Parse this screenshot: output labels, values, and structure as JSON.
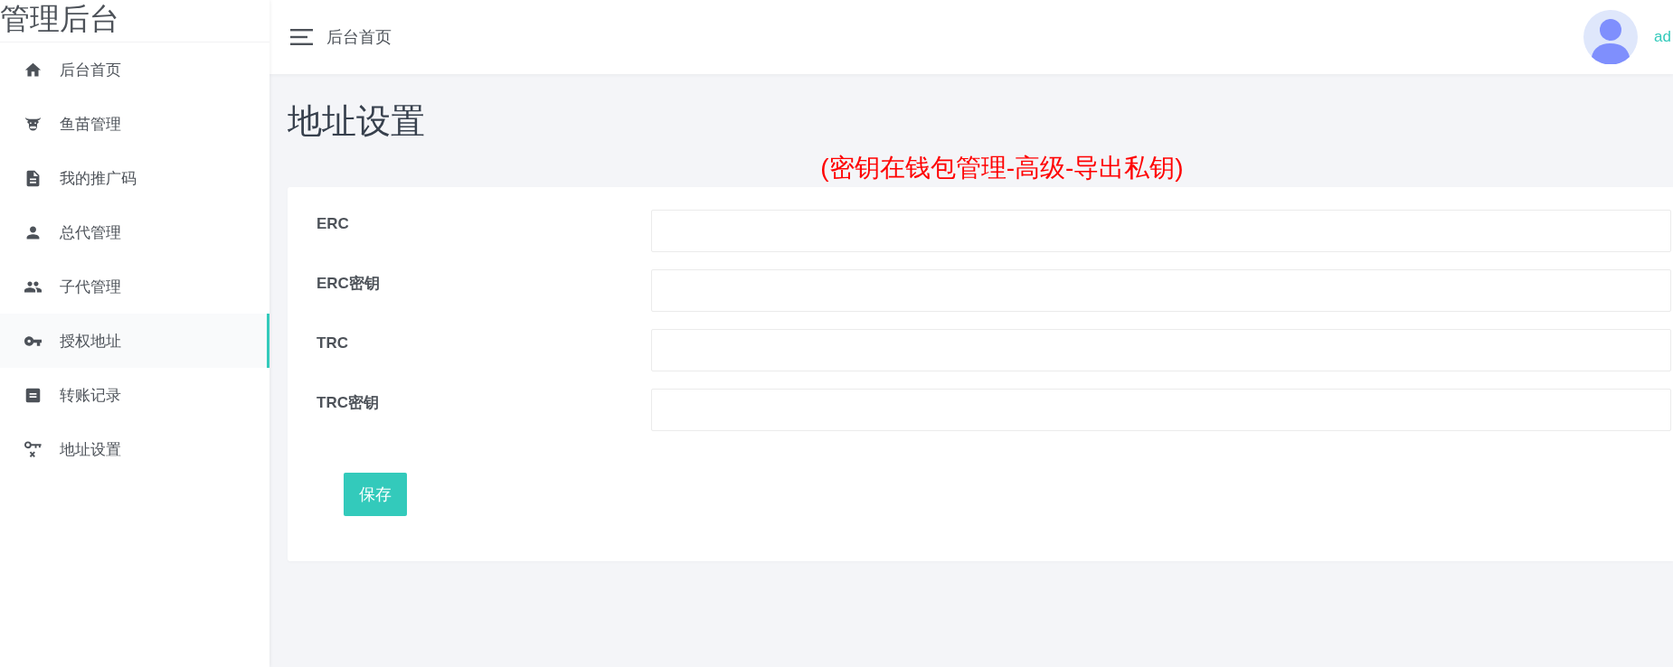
{
  "sidebar": {
    "logo": "管理后台",
    "items": [
      {
        "label": "后台首页",
        "selected": false
      },
      {
        "label": "鱼苗管理",
        "selected": false
      },
      {
        "label": "我的推广码",
        "selected": false
      },
      {
        "label": "总代管理",
        "selected": false
      },
      {
        "label": "子代管理",
        "selected": false
      },
      {
        "label": "授权地址",
        "selected": true
      },
      {
        "label": "转账记录",
        "selected": false
      },
      {
        "label": "地址设置",
        "selected": false
      }
    ]
  },
  "header": {
    "breadcrumb": "后台首页",
    "user": "ad"
  },
  "page": {
    "title": "地址设置",
    "note": "(密钥在钱包管理-高级-导出私钥)"
  },
  "form": {
    "fields": [
      {
        "label": "ERC"
      },
      {
        "label": "ERC密钥"
      },
      {
        "label": "TRC"
      },
      {
        "label": "TRC密钥"
      }
    ],
    "submit": "保存"
  }
}
